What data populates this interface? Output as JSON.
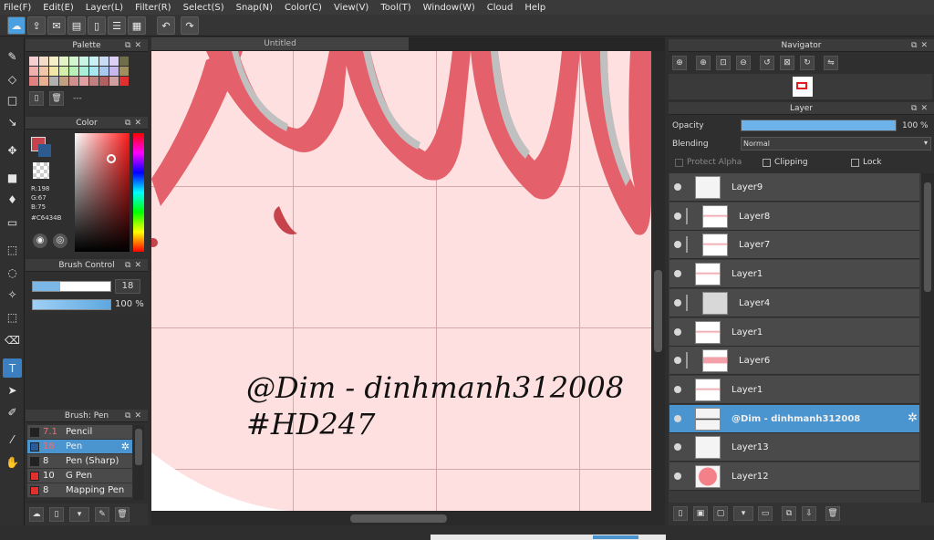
{
  "menu": [
    "File(F)",
    "Edit(E)",
    "Layer(L)",
    "Filter(R)",
    "Select(S)",
    "Snap(N)",
    "Color(C)",
    "View(V)",
    "Tool(T)",
    "Window(W)",
    "Cloud",
    "Help"
  ],
  "canvas": {
    "title": "Untitled",
    "watermark_line1": "@Dim - dinhmanh312008",
    "watermark_line2": "#HD247"
  },
  "palette": {
    "title": "Palette",
    "sub_label": "---"
  },
  "color": {
    "title": "Color",
    "r": "R:198",
    "g": "G:67",
    "b": "B:75",
    "hex": "#C6434B",
    "current": "#c6434b"
  },
  "brush_control": {
    "title": "Brush Control",
    "size": "18",
    "opacity": "100 %"
  },
  "brush_list": {
    "title": "Brush: Pen",
    "items": [
      {
        "size": "7.1",
        "name": "Pencil",
        "color": "#222222"
      },
      {
        "size": "18",
        "name": "Pen",
        "color": "#2a5c98"
      },
      {
        "size": "8",
        "name": "Pen (Sharp)",
        "color": "#222222"
      },
      {
        "size": "10",
        "name": "G Pen",
        "color": "#e03030"
      },
      {
        "size": "8",
        "name": "Mapping Pen",
        "color": "#e03030"
      }
    ]
  },
  "navigator": {
    "title": "Navigator"
  },
  "layer_panel": {
    "title": "Layer",
    "opacity_label": "Opacity",
    "opacity_value": "100 %",
    "opacity_fraction": 1.0,
    "blending_label": "Blending",
    "blending_value": "Normal",
    "protect_alpha": "Protect Alpha",
    "clipping": "Clipping",
    "lock": "Lock",
    "layers": [
      {
        "name": "Layer9",
        "clipped": false,
        "selected": false
      },
      {
        "name": "Layer8",
        "clipped": true,
        "selected": false
      },
      {
        "name": "Layer7",
        "clipped": true,
        "selected": false
      },
      {
        "name": "Layer1",
        "clipped": false,
        "selected": false
      },
      {
        "name": "Layer4",
        "clipped": true,
        "selected": false
      },
      {
        "name": "Layer1",
        "clipped": false,
        "selected": false
      },
      {
        "name": "Layer6",
        "clipped": true,
        "selected": false
      },
      {
        "name": "Layer1",
        "clipped": false,
        "selected": false
      },
      {
        "name": "@Dim - dinhmanh312008",
        "clipped": false,
        "selected": true
      },
      {
        "name": "Layer13",
        "clipped": false,
        "selected": false
      },
      {
        "name": "Layer12",
        "clipped": false,
        "selected": false
      }
    ]
  },
  "colors": {
    "accent": "#4a95d0",
    "canvas_bg": "#ffe0e0",
    "hair": "#e4606a"
  }
}
